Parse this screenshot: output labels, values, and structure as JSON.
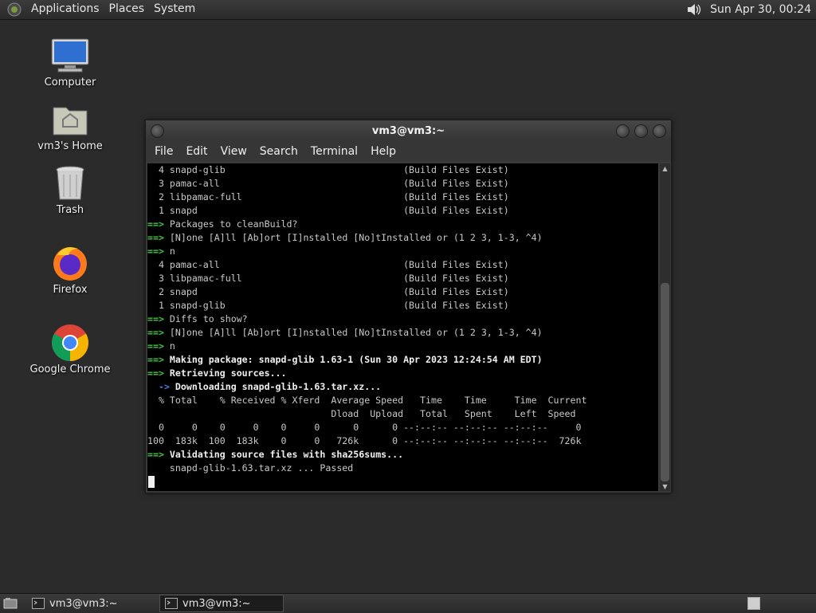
{
  "top_panel": {
    "menus": [
      "Applications",
      "Places",
      "System"
    ],
    "clock": "Sun Apr 30, 00:24",
    "icons": {
      "logo": "gnome-foot-icon",
      "volume": "volume-icon"
    }
  },
  "desktop": {
    "icons": [
      {
        "label": "Computer",
        "icon": "computer-icon"
      },
      {
        "label": "vm3's Home",
        "icon": "home-folder-icon"
      },
      {
        "label": "Trash",
        "icon": "trash-icon"
      },
      {
        "label": "Firefox",
        "icon": "firefox-icon"
      },
      {
        "label": "Google Chrome",
        "icon": "chrome-icon"
      }
    ]
  },
  "terminal": {
    "title": "vm3@vm3:~",
    "menu": [
      "File",
      "Edit",
      "View",
      "Search",
      "Terminal",
      "Help"
    ],
    "lines": [
      {
        "arrow": "",
        "text": "  4 snapd-glib                                (Build Files Exist)"
      },
      {
        "arrow": "",
        "text": "  3 pamac-all                                 (Build Files Exist)"
      },
      {
        "arrow": "",
        "text": "  2 libpamac-full                             (Build Files Exist)"
      },
      {
        "arrow": "",
        "text": "  1 snapd                                     (Build Files Exist)"
      },
      {
        "arrow": "==>",
        "text": " Packages to cleanBuild?"
      },
      {
        "arrow": "==>",
        "text": " [N]one [A]ll [Ab]ort [I]nstalled [No]tInstalled or (1 2 3, 1-3, ^4)"
      },
      {
        "arrow": "==>",
        "text": " n"
      },
      {
        "arrow": "",
        "text": "  4 pamac-all                                 (Build Files Exist)"
      },
      {
        "arrow": "",
        "text": "  3 libpamac-full                             (Build Files Exist)"
      },
      {
        "arrow": "",
        "text": "  2 snapd                                     (Build Files Exist)"
      },
      {
        "arrow": "",
        "text": "  1 snapd-glib                                (Build Files Exist)"
      },
      {
        "arrow": "==>",
        "text": " Diffs to show?"
      },
      {
        "arrow": "==>",
        "text": " [N]one [A]ll [Ab]ort [I]nstalled [No]tInstalled or (1 2 3, 1-3, ^4)"
      },
      {
        "arrow": "==>",
        "text": " n"
      },
      {
        "arrow": "==>",
        "text": " Making package: snapd-glib 1.63-1 (Sun 30 Apr 2023 12:24:54 AM EDT)",
        "bold": true
      },
      {
        "arrow": "==>",
        "text": " Retrieving sources...",
        "bold": true
      },
      {
        "arrow": "  ->",
        "text": " Downloading snapd-glib-1.63.tar.xz...",
        "bold": true,
        "blue": true
      },
      {
        "arrow": "",
        "text": "  % Total    % Received % Xferd  Average Speed   Time    Time     Time  Current"
      },
      {
        "arrow": "",
        "text": "                                 Dload  Upload   Total   Spent    Left  Speed"
      },
      {
        "arrow": "",
        "text": "  0     0    0     0    0     0      0      0 --:--:-- --:--:-- --:--:--     0"
      },
      {
        "arrow": "",
        "text": "100  183k  100  183k    0     0   726k      0 --:--:-- --:--:-- --:--:--  726k"
      },
      {
        "arrow": "==>",
        "text": " Validating source files with sha256sums...",
        "bold": true
      },
      {
        "arrow": "",
        "text": "    snapd-glib-1.63.tar.xz ... Passed"
      }
    ]
  },
  "taskbar": {
    "tasks": [
      {
        "label": "vm3@vm3:~",
        "active": false
      },
      {
        "label": "vm3@vm3:~",
        "active": true
      }
    ],
    "icons": {
      "show_desktop": "show-desktop-icon",
      "task": "terminal-icon",
      "workspace": "workspace-switcher-icon"
    }
  },
  "colors": {
    "arrow_green": "#3ec83e",
    "arrow_blue": "#4a7fd8",
    "panel": "#2f2f2f"
  }
}
